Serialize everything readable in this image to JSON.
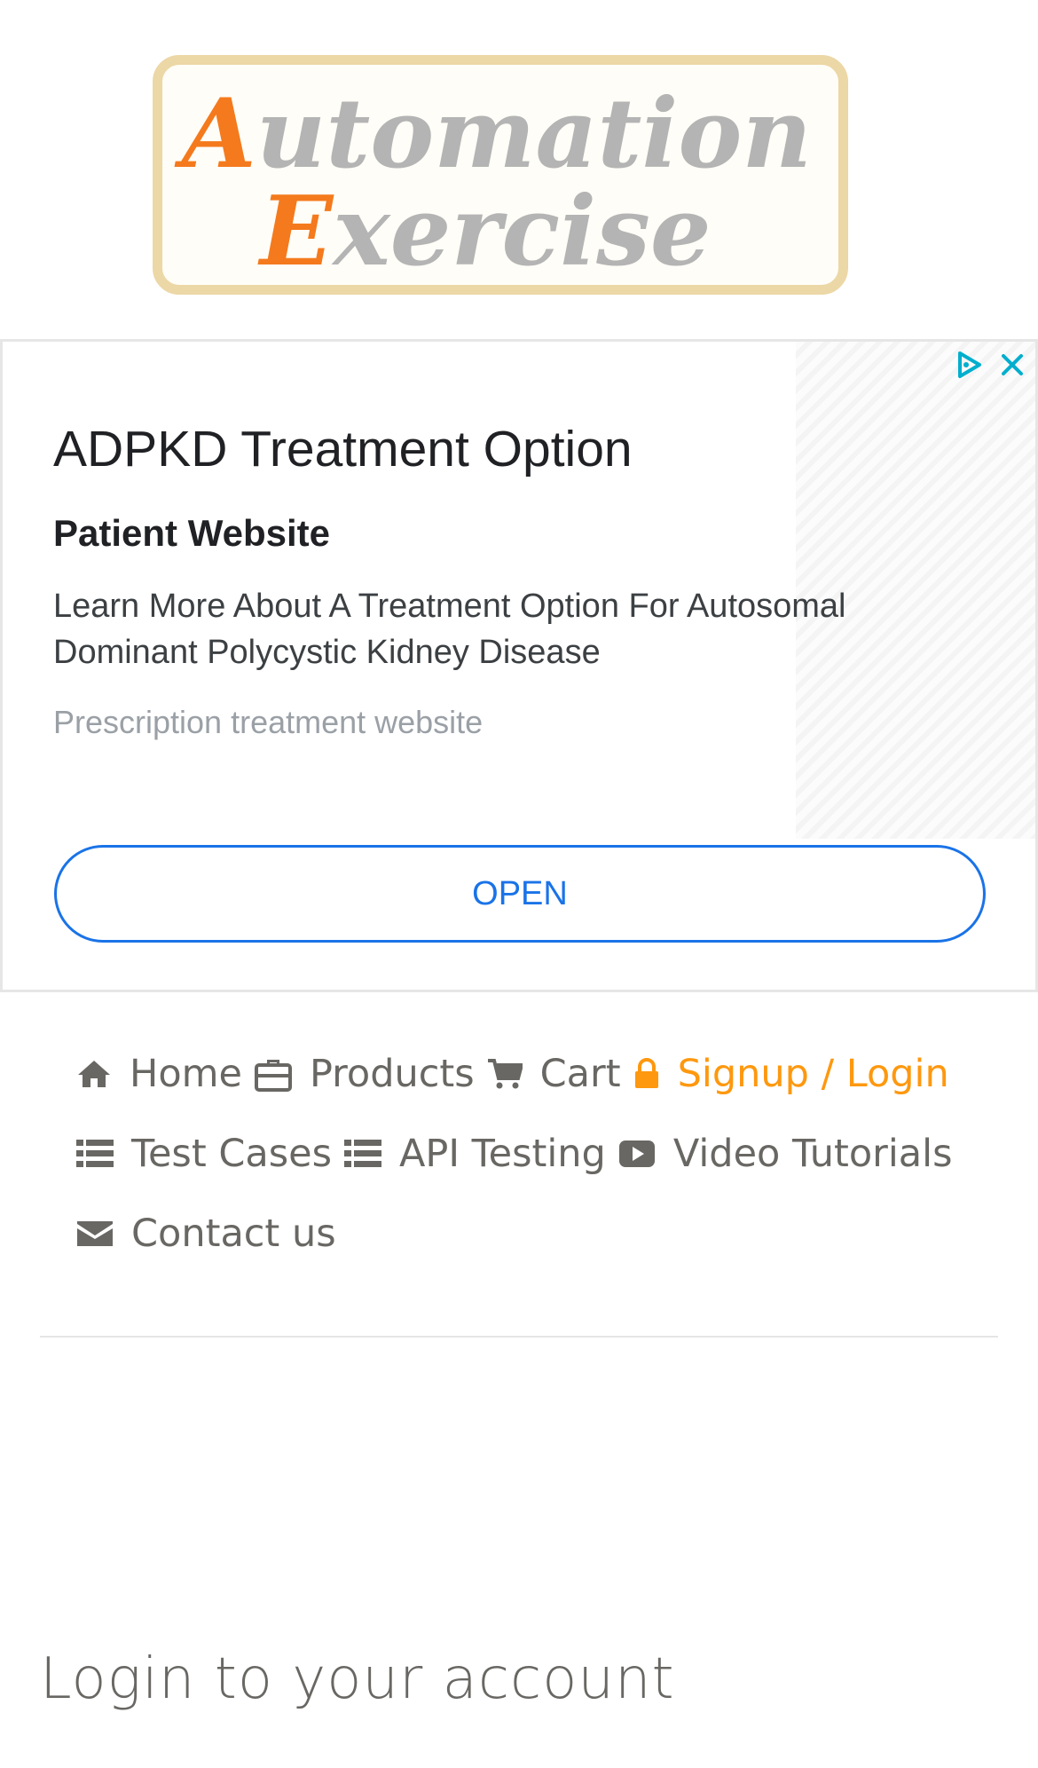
{
  "logo": {
    "line1_cap": "A",
    "line1_rest": "utomation",
    "line2_cap": "E",
    "line2_rest": "xercise"
  },
  "ad": {
    "headline": "ADPKD Treatment Option",
    "subheadline": "Patient Website",
    "description": "Learn More About A Treatment Option For Autosomal Dominant Polycystic Kidney Disease",
    "source": "Prescription treatment website",
    "cta_label": "OPEN"
  },
  "nav": {
    "items": [
      {
        "label": "Home",
        "icon": "home-icon"
      },
      {
        "label": "Products",
        "icon": "briefcase-icon"
      },
      {
        "label": "Cart",
        "icon": "cart-icon"
      },
      {
        "label": "Signup / Login",
        "icon": "lock-icon",
        "active": true
      },
      {
        "label": "Test Cases",
        "icon": "list-icon"
      },
      {
        "label": "API Testing",
        "icon": "list-icon"
      },
      {
        "label": "Video Tutorials",
        "icon": "youtube-play-icon"
      },
      {
        "label": "Contact us",
        "icon": "envelope-icon"
      }
    ]
  },
  "login": {
    "title": "Login to your account"
  },
  "colors": {
    "accent": "#fe980f",
    "nav_text": "#696763",
    "ad_blue": "#1a73e8",
    "logo_orange": "#f47a1d",
    "logo_border": "#ecd7a6"
  }
}
